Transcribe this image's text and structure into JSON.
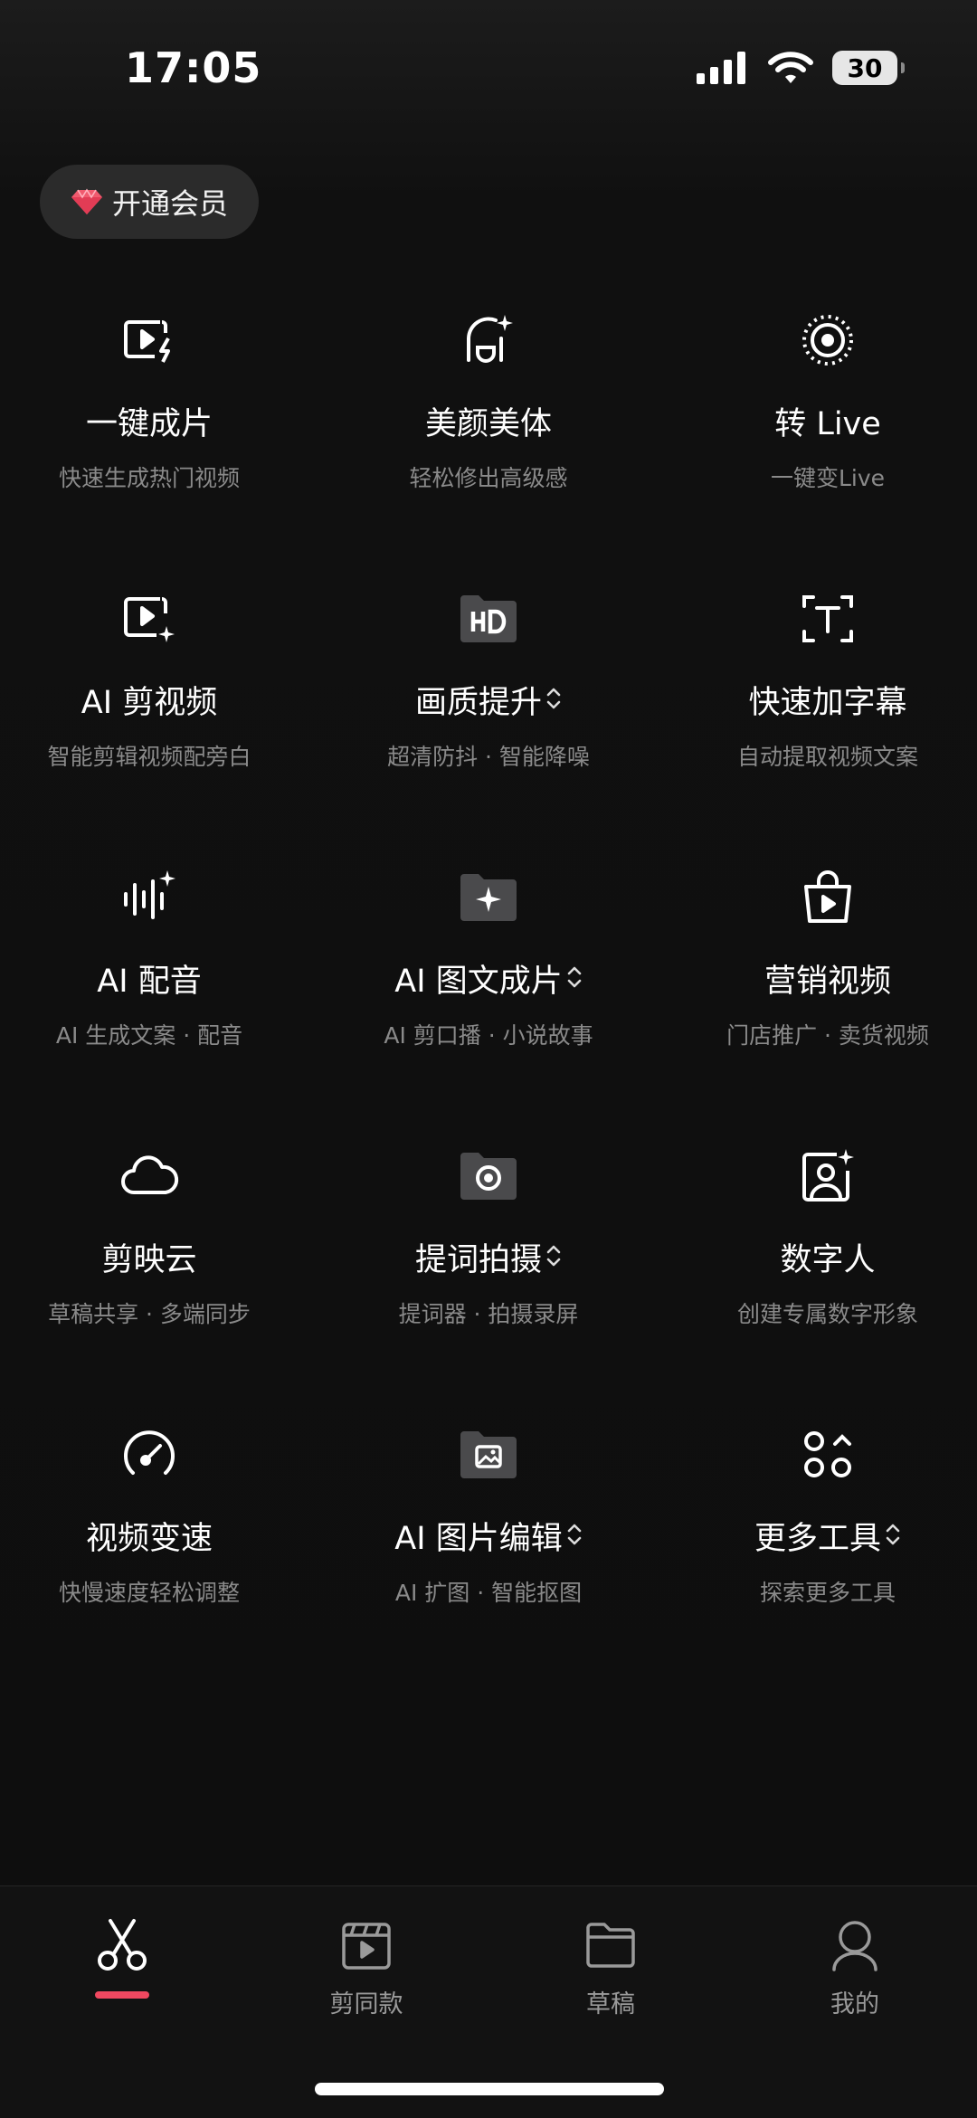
{
  "status": {
    "time": "17:05",
    "battery": "30"
  },
  "member_button": {
    "label": "开通会员",
    "icon": "diamond-icon"
  },
  "tools": [
    {
      "id": "one-click",
      "title": "一键成片",
      "subtitle": "快速生成热门视频",
      "icon": "video-flash-icon",
      "switchable": false
    },
    {
      "id": "beauty",
      "title": "美颜美体",
      "subtitle": "轻松修出高级感",
      "icon": "face-sparkle-icon",
      "switchable": false
    },
    {
      "id": "live",
      "title": "转 Live",
      "subtitle": "一键变Live",
      "icon": "live-photo-icon",
      "switchable": false
    },
    {
      "id": "ai-edit",
      "title": "AI 剪视频",
      "subtitle": "智能剪辑视频配旁白",
      "icon": "video-sparkle-icon",
      "switchable": false
    },
    {
      "id": "quality",
      "title": "画质提升",
      "subtitle": "超清防抖 · 智能降噪",
      "icon": "hd-folder-icon",
      "switchable": true
    },
    {
      "id": "captions",
      "title": "快速加字幕",
      "subtitle": "自动提取视频文案",
      "icon": "text-frame-icon",
      "switchable": false
    },
    {
      "id": "ai-voice",
      "title": "AI 配音",
      "subtitle": "AI 生成文案 · 配音",
      "icon": "waveform-icon",
      "switchable": false
    },
    {
      "id": "ai-imgtext",
      "title": "AI 图文成片",
      "subtitle": "AI 剪口播 · 小说故事",
      "icon": "sparkle-folder-icon",
      "switchable": true
    },
    {
      "id": "marketing",
      "title": "营销视频",
      "subtitle": "门店推广 · 卖货视频",
      "icon": "shopping-bag-icon",
      "switchable": false
    },
    {
      "id": "cloud",
      "title": "剪映云",
      "subtitle": "草稿共享 · 多端同步",
      "icon": "cloud-icon",
      "switchable": false
    },
    {
      "id": "teleprompter",
      "title": "提词拍摄",
      "subtitle": "提词器 · 拍摄录屏",
      "icon": "record-folder-icon",
      "switchable": true
    },
    {
      "id": "avatar",
      "title": "数字人",
      "subtitle": "创建专属数字形象",
      "icon": "person-sparkle-icon",
      "switchable": false
    },
    {
      "id": "speed",
      "title": "视频变速",
      "subtitle": "快慢速度轻松调整",
      "icon": "speedometer-icon",
      "switchable": false
    },
    {
      "id": "ai-image",
      "title": "AI 图片编辑",
      "subtitle": "AI 扩图 · 智能抠图",
      "icon": "image-folder-icon",
      "switchable": true
    },
    {
      "id": "more",
      "title": "更多工具",
      "subtitle": "探索更多工具",
      "icon": "more-tools-icon",
      "switchable": true
    }
  ],
  "updown_glyph": "⌃⌄",
  "bottom_nav": [
    {
      "id": "edit",
      "label": "",
      "icon": "scissors-icon",
      "active": true
    },
    {
      "id": "templates",
      "label": "剪同款",
      "icon": "clapper-icon",
      "active": false
    },
    {
      "id": "drafts",
      "label": "草稿",
      "icon": "folder-icon",
      "active": false
    },
    {
      "id": "me",
      "label": "我的",
      "icon": "user-icon",
      "active": false
    }
  ],
  "colors": {
    "accent": "#f04860",
    "background": "#0e0e0e",
    "subtitle": "#8a8a8a"
  }
}
